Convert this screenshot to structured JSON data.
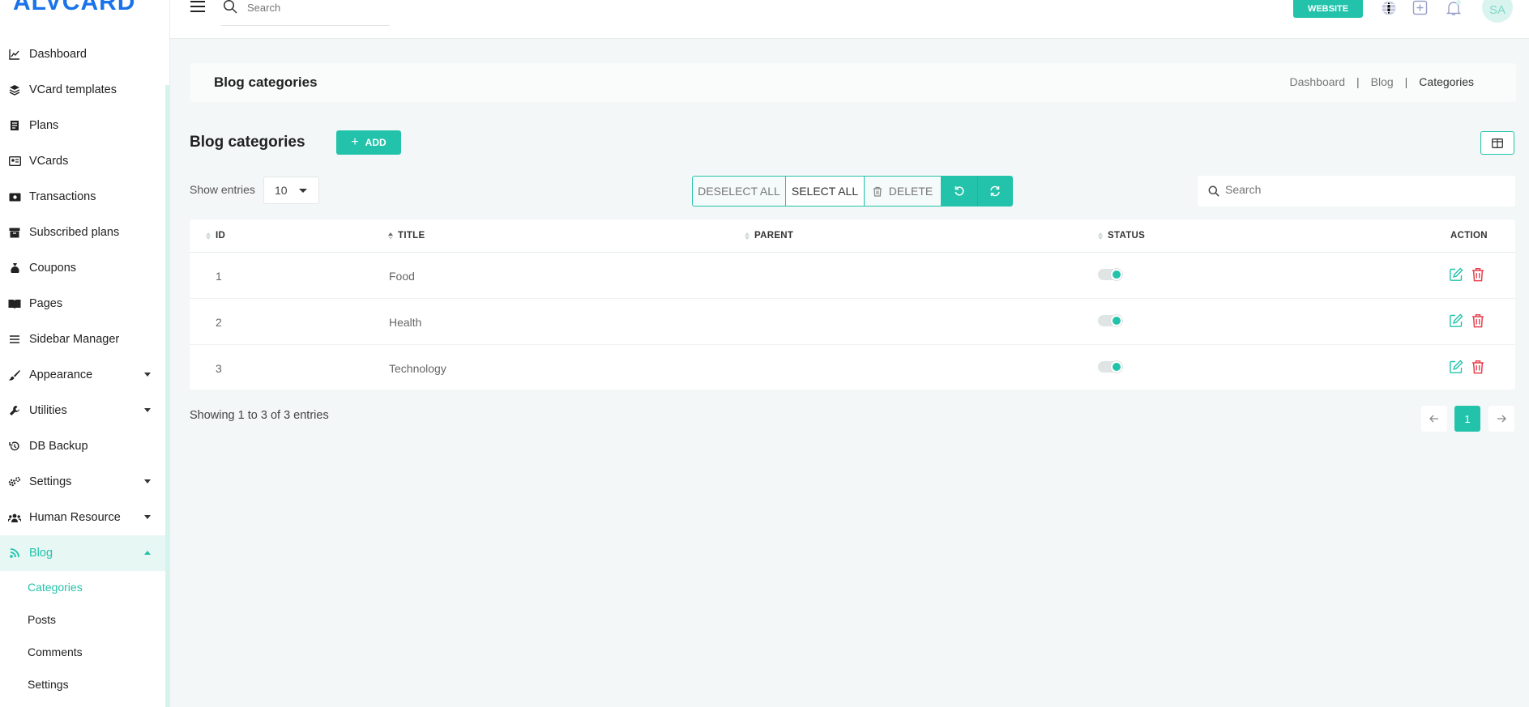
{
  "app": {
    "logo_text": "ALVCARD"
  },
  "colors": {
    "accent": "#22c3aa",
    "danger": "#e8404f"
  },
  "sidebar": {
    "items": [
      {
        "label": "Dashboard",
        "icon": "chart-line-icon",
        "has_caret": false,
        "active": false
      },
      {
        "label": "VCard templates",
        "icon": "layers-icon",
        "has_caret": false,
        "active": false
      },
      {
        "label": "Plans",
        "icon": "receipt-icon",
        "has_caret": false,
        "active": false
      },
      {
        "label": "VCards",
        "icon": "id-card-icon",
        "has_caret": false,
        "active": false
      },
      {
        "label": "Transactions",
        "icon": "money-icon",
        "has_caret": false,
        "active": false
      },
      {
        "label": "Subscribed plans",
        "icon": "archive-icon",
        "has_caret": false,
        "active": false
      },
      {
        "label": "Coupons",
        "icon": "money-bag-icon",
        "has_caret": false,
        "active": false
      },
      {
        "label": "Pages",
        "icon": "book-open-icon",
        "has_caret": false,
        "active": false
      },
      {
        "label": "Sidebar Manager",
        "icon": "list-icon",
        "has_caret": false,
        "active": false
      },
      {
        "label": "Appearance",
        "icon": "brush-icon",
        "has_caret": true,
        "active": false
      },
      {
        "label": "Utilities",
        "icon": "wrench-icon",
        "has_caret": true,
        "active": false
      },
      {
        "label": "DB Backup",
        "icon": "history-icon",
        "has_caret": false,
        "active": false
      },
      {
        "label": "Settings",
        "icon": "gears-icon",
        "has_caret": true,
        "active": false
      },
      {
        "label": "Human Resource",
        "icon": "users-icon",
        "has_caret": true,
        "active": false
      },
      {
        "label": "Blog",
        "icon": "blog-icon",
        "has_caret": true,
        "active": true
      }
    ],
    "sub_items": [
      {
        "label": "Categories",
        "active": true
      },
      {
        "label": "Posts",
        "active": false
      },
      {
        "label": "Comments",
        "active": false
      },
      {
        "label": "Settings",
        "active": false
      }
    ]
  },
  "topbar": {
    "search_placeholder": "Search",
    "website_label": "WEBSITE",
    "avatar_initials": "SA"
  },
  "header": {
    "title": "Blog categories",
    "breadcrumb": [
      "Dashboard",
      "Blog",
      "Categories"
    ]
  },
  "section": {
    "title": "Blog categories",
    "add_label": "ADD",
    "show_entries_label": "Show entries",
    "entries_value": "10",
    "deselect_all_label": "DESELECT ALL",
    "select_all_label": "SELECT ALL",
    "delete_label": "DELETE",
    "search_placeholder": "Search"
  },
  "table": {
    "columns": [
      "ID",
      "TITLE",
      "PARENT",
      "STATUS",
      "ACTION"
    ],
    "rows": [
      {
        "id": "1",
        "title": "Food",
        "parent": "",
        "status": true
      },
      {
        "id": "2",
        "title": "Health",
        "parent": "",
        "status": true
      },
      {
        "id": "3",
        "title": "Technology",
        "parent": "",
        "status": true
      }
    ]
  },
  "footer": {
    "showing_text": "Showing 1 to 3 of 3 entries",
    "current_page": "1"
  }
}
